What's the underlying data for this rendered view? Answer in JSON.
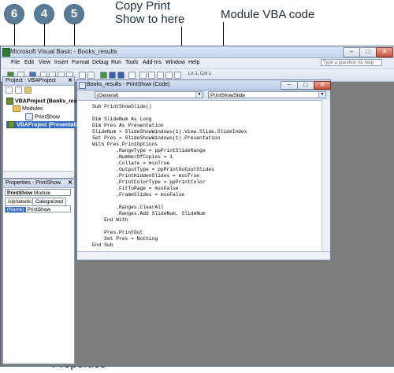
{
  "callouts": {
    "step6": "6",
    "step4": "4",
    "step5": "5",
    "copy_print_line1": "Copy Print",
    "copy_print_line2": "Show to here",
    "module_vba_code": "Module VBA code",
    "properties": "Properties"
  },
  "window": {
    "title": "Microsoft Visual Basic - Books_results",
    "minimize": "–",
    "maximize": "□",
    "close": "✕"
  },
  "menu": {
    "items": [
      "File",
      "Edit",
      "View",
      "Insert",
      "Format",
      "Debug",
      "Run",
      "Tools",
      "Add-Ins",
      "Window",
      "Help"
    ],
    "help_placeholder": "Type a question for help"
  },
  "toolbar": {
    "position_text": "Ln 1, Col 1"
  },
  "project_panel": {
    "title": "Project - VBAProject",
    "close": "✕",
    "tree": [
      "VBAProject (Books_resu",
      "Modules",
      "PrintShow",
      "VBAProject (Presentatio"
    ]
  },
  "properties_panel": {
    "title": "Properties - PrintShow",
    "close": "✕",
    "object_name": "PrintShow",
    "object_type": "Module",
    "tabs": [
      "Alphabetic",
      "Categorized"
    ],
    "prop_name": "(Name)",
    "prop_value": "PrintShow"
  },
  "code_window": {
    "title": "Books_results - PrintShow (Code)",
    "object_combo": "(General)",
    "procedure_combo": "PrintShowSlide",
    "lines": [
      "Sub PrintShowSlide()",
      "",
      "Dim SlideNum As Long",
      "Dim Pres As Presentation",
      "SlideNum = SlideShowWindows(1).View.Slide.SlideIndex",
      "Set Pres = SlideShowWindows(1).Presentation",
      "With Pres.PrintOptions",
      "        .RangeType = ppPrintSlideRange",
      "        .NumberOfCopies = 1",
      "        .Collate = msoTrue",
      "        .OutputType = ppPrintOutputSlides",
      "        .PrintHiddenSlides = msoTrue",
      "        .PrintColorType = ppPrintColor",
      "        .FitToPage = msoFalse",
      "        .FrameSlides = msoFalse",
      "",
      "        .Ranges.ClearAll",
      "        .Ranges.Add SlideNum, SlideNum",
      "    End With",
      "",
      "    Pres.PrintOut",
      "    Set Pres = Nothing",
      "End Sub"
    ]
  }
}
